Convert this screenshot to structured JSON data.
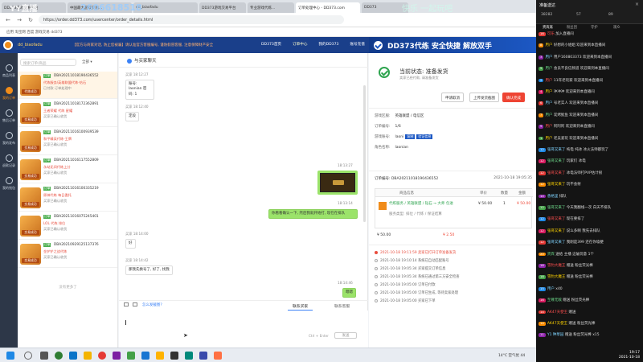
{
  "browser": {
    "tabs": [
      "DD373游戏交易平台",
      "中国最大游戏交易...",
      "dd_biaofadu",
      "DD373游戏交易平台",
      "专业游戏代练...",
      "订单处理中心 - DD373.com",
      "DD373"
    ],
    "active_tab": 5,
    "url": "https://order.dd373.com/usercenter/order_details.html",
    "bookmarks": "应用   淘宝网   百度   游戏交易   dd373"
  },
  "overlay": {
    "left": "YY直播",
    "id": "2606618518",
    "right": "快乐 一起玩吧"
  },
  "site": {
    "user": "dd_biaofadu",
    "notice": "【官方与商家对话, 防止您被骗】请认准官方客服编号, 谨防假冒客服, 注意保障财产安全",
    "nav": [
      "DD373首页",
      "订单中心",
      "我的DD373",
      "账号充值",
      "客服中心",
      "手机APP"
    ],
    "left_icons": [
      "商品列表",
      "我的订单",
      "售后订单",
      "我的发布",
      "退款记录",
      "我的钱包"
    ]
  },
  "orders": {
    "search_placeholder": "搜索订单/商品",
    "filter": "全部 ▾",
    "items": [
      {
        "badge": "订单",
        "no": "DBA20211018190436552",
        "title": "代练服务/英雄联盟代练-钻石",
        "sub": "已付款 订单处理中",
        "thumb": "代练成功"
      },
      {
        "badge": "订单",
        "no": "DBA20211018172362891",
        "title": "王者荣耀 代练 星耀",
        "sub": "买家已确认收货",
        "thumb": "交易成功"
      },
      {
        "badge": "订单",
        "no": "DBA20211016100939539",
        "title": "和平精英代练-王牌",
        "sub": "买家已确认收货",
        "thumb": "交易成功"
      },
      {
        "badge": "订单",
        "no": "DBA20211016117552809",
        "title": "永劫无间代练上分",
        "sub": "买家已确认收货",
        "thumb": "交易成功"
      },
      {
        "badge": "订单",
        "no": "DBA20211016100335219",
        "title": "原神代练 每日委托",
        "sub": "买家已确认收货",
        "thumb": "交易成功"
      },
      {
        "badge": "订单",
        "no": "DBA20211016075245401",
        "title": "LOL 代练 排位",
        "sub": "买家已确认收货",
        "thumb": "交易成功"
      },
      {
        "badge": "订单",
        "no": "DBA20210929125137376",
        "title": "金铲铲之战代练",
        "sub": "买家已确认收货",
        "thumb": "交易成功"
      }
    ],
    "no_more": "没有更多了"
  },
  "chat": {
    "title": "与买家聊天",
    "messages": [
      {
        "who": "买家",
        "time": "18:12:27",
        "text": "账号: laonian 密码: 1",
        "me": false
      },
      {
        "who": "买家",
        "time": "18:12:40",
        "text": "定段",
        "me": false
      },
      {
        "who": "",
        "time": "18:13:27",
        "text": "",
        "me": true,
        "image": true
      },
      {
        "who": "",
        "time": "18:13:14",
        "text": "你看看确认一下, 然后我就开始打, 现在在排队",
        "me": true
      },
      {
        "who": "买家",
        "time": "18:14:00",
        "text": "好",
        "me": false
      },
      {
        "who": "买家",
        "time": "18:14:42",
        "text": "那我先换号了, 好了, 找我",
        "me": false
      },
      {
        "who": "",
        "time": "18:14:46",
        "text": "嗯嗯",
        "me": true
      }
    ],
    "quick_reply": "怎么发截图?",
    "tab_buyer": "联系买家",
    "tab_seller": "联系客服",
    "send_hint": "Ctrl + Enter",
    "send": "发送"
  },
  "detail": {
    "banner": "DD373代练  安全快捷  解放双手",
    "status": "当前状态: 准备发货",
    "status_sub": "卖家已经付款, 请准备发货",
    "buttons": [
      "申请取消",
      "上传发货截图",
      "确认完成"
    ],
    "rows": [
      {
        "label": "游戏区服:",
        "value": "英雄联盟 / 电信区"
      },
      {
        "label": "订单编号:",
        "value": "1/6"
      },
      {
        "label": "游戏账号:",
        "value": "laoni",
        "chip1": "复制",
        "chip2": "验证信息"
      },
      {
        "label": "角色名称:",
        "value": "laonian"
      }
    ],
    "order_no_label": "订单编号: DBA20211018190436552",
    "order_time": "2021-10-18 19:05:35",
    "table_headers": [
      "商品信息",
      "单价",
      "数量",
      "金额"
    ],
    "goods_name": "代练服务 / 英雄联盟 / 钻石 → 大师 包进",
    "goods_sub": "服务类型: 排位 / 代练 / 保证结算",
    "unit_price": "¥ 50.00",
    "qty": "1",
    "amount": "¥ 50.00",
    "price_left": "¥ 50.00",
    "price_right": "¥ 2.50",
    "timeline": [
      "2021-10-18 19:11:59  卖家已打开订单准备发货",
      "2021-10-18 19:10:14  系统已自动匹配账号",
      "2021-10-18 19:05:34  买家提交订单信息",
      "2021-10-18 19:05:34  系统已通过第三方安全检查",
      "2021-10-18 19:05:00  订单已付款",
      "2021-10-18 19:05:00  订单已生成, 等待卖家处理",
      "2021-10-18 19:05:00  买家已下单"
    ]
  },
  "taskbar": {
    "weather": "14°C 空气优 44",
    "time": "19:17",
    "date": "2021-10-18"
  },
  "live": {
    "title": "准备送达",
    "stats": [
      "38282",
      "57",
      "89"
    ],
    "tabs": [
      "贵宾席",
      "粉丝团",
      "守护",
      "观众"
    ],
    "messages": [
      {
        "lv": "16",
        "name": "可乐",
        "text": "加入直播间"
      },
      {
        "lv": "8",
        "name": "用户",
        "text": "好想的小姐姐 欢迎来到本直播间"
      },
      {
        "lv": "3",
        "name": "用户",
        "text": "用户160803373 欢迎来到本直播间"
      },
      {
        "lv": "5",
        "name": "用户",
        "text": "会员不良信频道 欢迎来到本直播间"
      },
      {
        "lv": "2",
        "name": "用户",
        "text": "11年老玩家 欢迎来到本直播间"
      },
      {
        "lv": "4",
        "name": "用户",
        "text": "冲冲冲 欢迎来到本直播间"
      },
      {
        "lv": "6",
        "name": "用户",
        "text": "号老实人 欢迎来到本直播间"
      },
      {
        "lv": "7",
        "name": "用户",
        "text": "炭烤鱿鱼 欢迎来到本直播间"
      },
      {
        "lv": "9",
        "name": "用户",
        "text": "阿阿阿 欢迎来到本直播间"
      },
      {
        "lv": "1",
        "name": "用户",
        "text": "老吴爱玩 欢迎来到本直播间"
      },
      {
        "lv": "12",
        "name": "强哥又来了",
        "text": "纯电 纯冰 冰火法师都玩了"
      },
      {
        "lv": "12",
        "name": "强哥又来了",
        "text": "玩家们 冰电"
      },
      {
        "lv": "12",
        "name": "强哥又来了",
        "text": "冰电法师打PVP估计很"
      },
      {
        "lv": "12",
        "name": "强哥又来了",
        "text": "玩不会射"
      },
      {
        "lv": "10",
        "name": "香格里",
        "text": "排队"
      },
      {
        "lv": "12",
        "name": "强哥又来了",
        "text": "今天我翻线一次 白天不排队"
      },
      {
        "lv": "12",
        "name": "强哥又来了",
        "text": "现在要排了"
      },
      {
        "lv": "12",
        "name": "强哥又来了",
        "text": "说么多啊 我先去排队"
      },
      {
        "lv": "12",
        "name": "强哥又来了",
        "text": "我刚是399 还在你墙梗"
      },
      {
        "lv": "20",
        "name": "贵宾",
        "text": "送给 主播 这破玩意 1个"
      },
      {
        "lv": "18",
        "name": "雪豹大魔王",
        "text": "赠送 粉丝荧光棒"
      },
      {
        "lv": "18",
        "name": "雪豹大魔王",
        "text": "赠送 粉丝荧光棒"
      },
      {
        "lv": "15",
        "name": "用户",
        "text": "x40"
      },
      {
        "lv": "16",
        "name": "至尊无敌",
        "text": "赠送 粉丝荧光棒"
      },
      {
        "lv": "14",
        "name": "AK47天使王",
        "text": "赠送"
      },
      {
        "lv": "14",
        "name": "AK47天使王",
        "text": "赠送 粉丝荧光棒"
      },
      {
        "lv": "11",
        "name": "Y1 种草园",
        "text": "赠送 粉丝荧光棒 x15"
      }
    ]
  },
  "colors": {
    "brand": "#1a3f8a",
    "accent": "#f08c1a",
    "success": "#2ea44f",
    "danger": "#ee4433"
  }
}
